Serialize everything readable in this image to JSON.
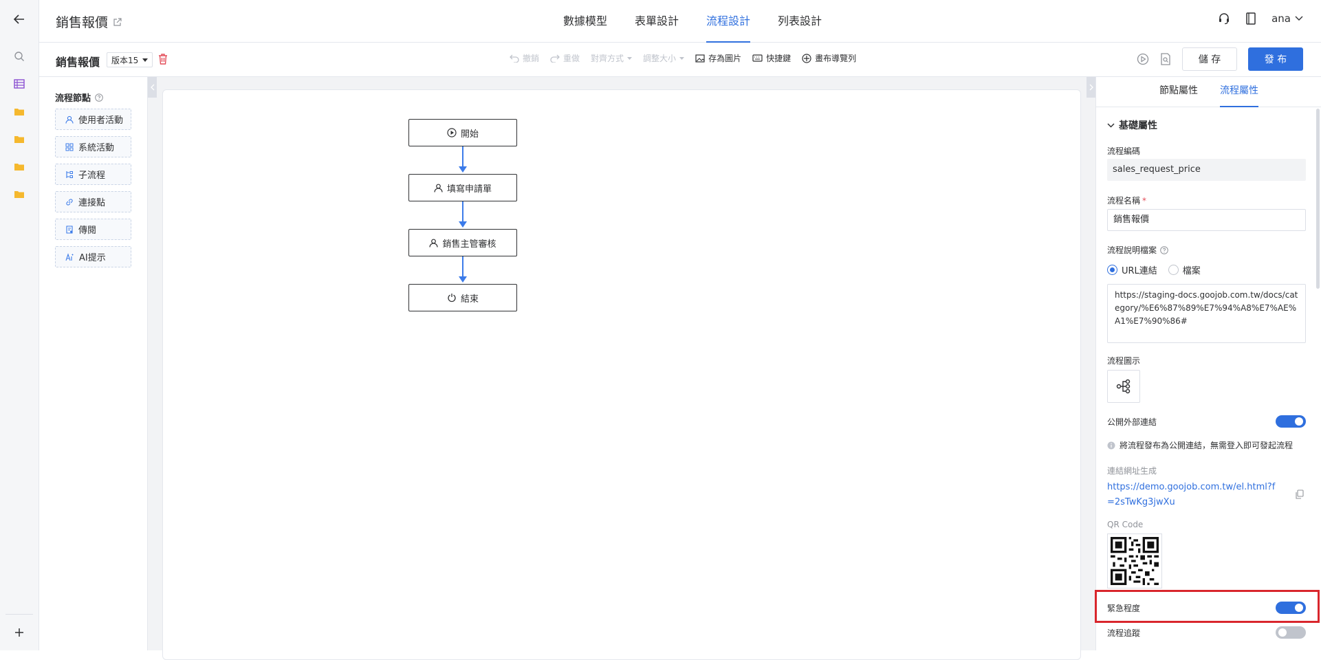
{
  "header": {
    "app_title": "銷售報價",
    "tabs": [
      {
        "label": "數據模型",
        "active": false
      },
      {
        "label": "表單設計",
        "active": false
      },
      {
        "label": "流程設計",
        "active": true
      },
      {
        "label": "列表設計",
        "active": false
      }
    ],
    "user": "ana"
  },
  "toolbar": {
    "flow_name": "銷售報價",
    "version": "版本15",
    "undo": "撤銷",
    "redo": "重做",
    "align": "對齊方式",
    "resize": "調整大小",
    "save_image": "存為圖片",
    "shortcuts": "快捷鍵",
    "canvas_nav": "畫布導覽列",
    "save": "儲 存",
    "publish": "發 布"
  },
  "node_panel": {
    "title": "流程節點",
    "items": [
      {
        "label": "使用者活動",
        "icon": "user-icon"
      },
      {
        "label": "系統活動",
        "icon": "grid-icon"
      },
      {
        "label": "子流程",
        "icon": "subflow-icon"
      },
      {
        "label": "連接點",
        "icon": "link-icon"
      },
      {
        "label": "傳閱",
        "icon": "circulate-icon"
      },
      {
        "label": "AI提示",
        "icon": "ai-icon"
      }
    ]
  },
  "flow": {
    "nodes": [
      {
        "label": "開始",
        "icon": "play-icon"
      },
      {
        "label": "填寫申請單",
        "icon": "user-icon"
      },
      {
        "label": "銷售主管審核",
        "icon": "user-icon"
      },
      {
        "label": "結束",
        "icon": "power-icon"
      }
    ]
  },
  "props": {
    "tabs": [
      {
        "label": "節點屬性",
        "active": false
      },
      {
        "label": "流程屬性",
        "active": true
      }
    ],
    "section": "基礎屬性",
    "code_label": "流程編碼",
    "code_value": "sales_request_price",
    "name_label": "流程名稱",
    "name_required": "*",
    "name_value": "銷售報價",
    "doc_label": "流程說明檔案",
    "doc_options": [
      "URL連結",
      "檔案"
    ],
    "doc_url": "https://staging-docs.goojob.com.tw/docs/category/%E6%87%89%E7%94%A8%E7%AE%A1%E7%90%86#",
    "icon_label": "流程圖示",
    "public_link_label": "公開外部連結",
    "public_link_on": true,
    "public_hint": "將流程發布為公開連結，無需登入即可發起流程",
    "link_gen_label": "連結網址生成",
    "link_url": "https://demo.goojob.com.tw/el.html?f=2sTwKg3jwXu",
    "qr_label": "QR Code",
    "urgency_label": "緊急程度",
    "urgency_on": true,
    "tracking_label": "流程追蹤",
    "tracking_on": false
  },
  "colors": {
    "accent": "#2f6fde",
    "highlight": "#d9262c",
    "folder": "#f5b82e"
  }
}
